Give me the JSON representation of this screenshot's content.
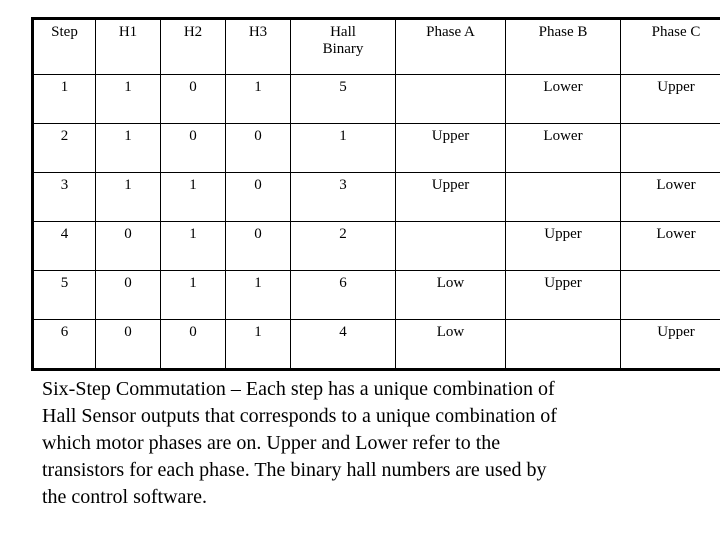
{
  "table": {
    "headers": [
      "Step",
      "H1",
      "H2",
      "H3",
      "Hall Binary",
      "Phase A",
      "Phase B",
      "Phase C"
    ],
    "header_hall_line1": "Hall",
    "header_hall_line2": "Binary",
    "rows": [
      {
        "step": "1",
        "h1": "1",
        "h2": "0",
        "h3": "1",
        "hall_binary": "5",
        "phase_a": "",
        "phase_b": "Lower",
        "phase_c": "Upper"
      },
      {
        "step": "2",
        "h1": "1",
        "h2": "0",
        "h3": "0",
        "hall_binary": "1",
        "phase_a": "Upper",
        "phase_b": "Lower",
        "phase_c": ""
      },
      {
        "step": "3",
        "h1": "1",
        "h2": "1",
        "h3": "0",
        "hall_binary": "3",
        "phase_a": "Upper",
        "phase_b": "",
        "phase_c": "Lower"
      },
      {
        "step": "4",
        "h1": "0",
        "h2": "1",
        "h3": "0",
        "hall_binary": "2",
        "phase_a": "",
        "phase_b": "Upper",
        "phase_c": "Lower"
      },
      {
        "step": "5",
        "h1": "0",
        "h2": "1",
        "h3": "1",
        "hall_binary": "6",
        "phase_a": "Low",
        "phase_b": "Upper",
        "phase_c": ""
      },
      {
        "step": "6",
        "h1": "0",
        "h2": "0",
        "h3": "1",
        "hall_binary": "4",
        "phase_a": "Low",
        "phase_b": "",
        "phase_c": "Upper"
      }
    ]
  },
  "caption": {
    "line1": "Six-Step Commutation – Each step has a unique combination of",
    "line2": "Hall Sensor outputs that corresponds to a unique combination of",
    "line3": "which motor phases are on. Upper and Lower refer to the",
    "line4": "transistors for each phase. The binary hall numbers are used by",
    "line5": "the control software."
  },
  "colors": {
    "background": "#ffffff",
    "text": "#000000",
    "border": "#000000"
  }
}
